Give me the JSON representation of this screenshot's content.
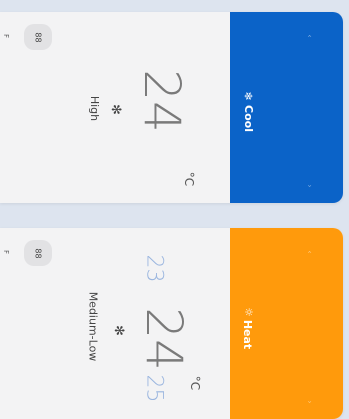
{
  "cards": [
    {
      "mode_label": "Cool",
      "mode_icon": "snowflake-icon",
      "temperature": "24",
      "unit": "°C",
      "fan_speed": "High",
      "fan_icon": "fan-icon",
      "chip_text": "88",
      "f_label": "F",
      "accent": "#0b63c8"
    },
    {
      "mode_label": "Heat",
      "mode_icon": "sun-icon",
      "temperature": "24",
      "lower_temp": "23",
      "upper_temp": "25",
      "unit": "°C",
      "fan_speed": "Medium-Low",
      "fan_icon": "fan-icon",
      "chip_text": "88",
      "f_label": "F",
      "accent": "#ff9a0c"
    }
  ]
}
